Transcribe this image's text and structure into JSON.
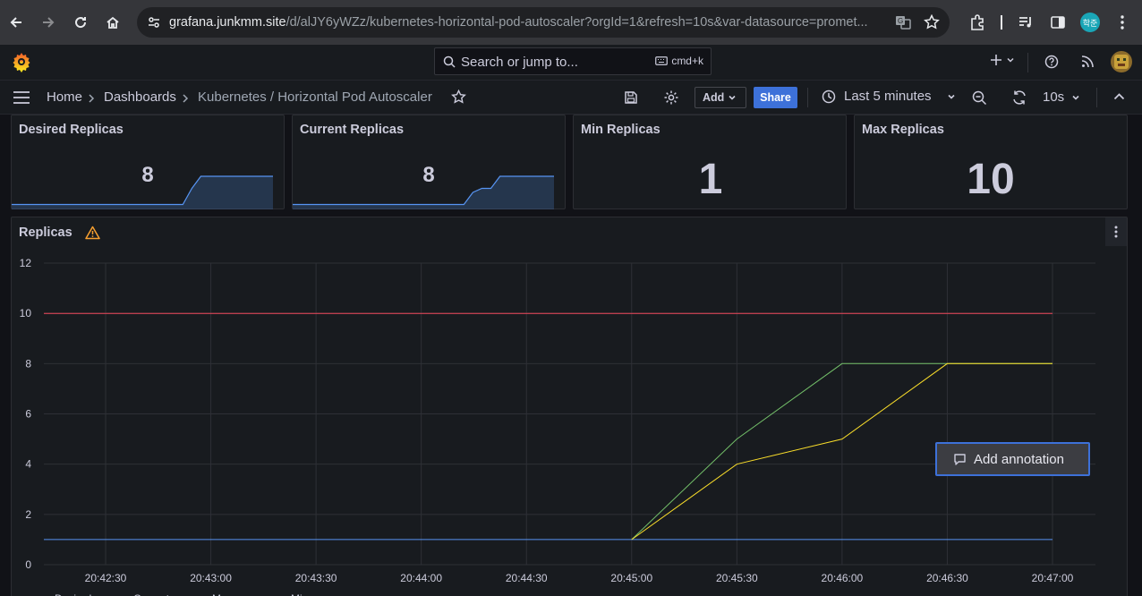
{
  "browser": {
    "url_host": "grafana.junkmm.site",
    "url_path": "/d/alJY6yWZz/kubernetes-horizontal-pod-autoscaler?orgId=1&refresh=10s&var-datasource=promet...",
    "profile_initial": "학준"
  },
  "topnav": {
    "search_placeholder": "Search or jump to...",
    "shortcut": "cmd+k"
  },
  "breadcrumb": {
    "home": "Home",
    "dashboards": "Dashboards",
    "current": "Kubernetes / Horizontal Pod Autoscaler"
  },
  "toolbar": {
    "add_label": "Add",
    "share_label": "Share",
    "time_range": "Last 5 minutes",
    "refresh_interval": "10s"
  },
  "stats": [
    {
      "title": "Desired Replicas",
      "value": "8",
      "sparkline": [
        1,
        1,
        1,
        1,
        1,
        1,
        1,
        1,
        1,
        1,
        1,
        1,
        1,
        1,
        1,
        1,
        1,
        1,
        1,
        1,
        5,
        8,
        8,
        8,
        8,
        8,
        8,
        8,
        8,
        8
      ]
    },
    {
      "title": "Current Replicas",
      "value": "8",
      "sparkline": [
        1,
        1,
        1,
        1,
        1,
        1,
        1,
        1,
        1,
        1,
        1,
        1,
        1,
        1,
        1,
        1,
        1,
        1,
        1,
        1,
        4,
        5,
        5,
        8,
        8,
        8,
        8,
        8,
        8,
        8
      ]
    },
    {
      "title": "Min Replicas",
      "value": "1"
    },
    {
      "title": "Max Replicas",
      "value": "10"
    }
  ],
  "replicas_panel": {
    "title": "Replicas",
    "annotation_label": "Add annotation",
    "legend_partial": [
      "Desired",
      "Current",
      "Max",
      "Min"
    ]
  },
  "chart_data": {
    "type": "line",
    "title": "Replicas",
    "x": [
      "20:42:30",
      "20:43:00",
      "20:43:30",
      "20:44:00",
      "20:44:30",
      "20:45:00",
      "20:45:30",
      "20:46:00",
      "20:46:30",
      "20:47:00"
    ],
    "ylim": [
      0,
      12
    ],
    "yticks": [
      0,
      2,
      4,
      6,
      8,
      10,
      12
    ],
    "grid": true,
    "series": [
      {
        "name": "Max",
        "color": "#f2495c",
        "points": [
          [
            "20:42:15",
            10
          ],
          [
            "20:47:00",
            10
          ]
        ]
      },
      {
        "name": "Min",
        "color": "#5794f2",
        "points": [
          [
            "20:42:15",
            1
          ],
          [
            "20:47:00",
            1
          ]
        ]
      },
      {
        "name": "Desired",
        "color": "#73bf69",
        "points": [
          [
            "20:45:00",
            1
          ],
          [
            "20:45:30",
            5
          ],
          [
            "20:46:00",
            8
          ],
          [
            "20:46:30",
            8
          ],
          [
            "20:47:00",
            8
          ]
        ]
      },
      {
        "name": "Current",
        "color": "#fade2a",
        "points": [
          [
            "20:45:00",
            1
          ],
          [
            "20:45:30",
            4
          ],
          [
            "20:46:00",
            5
          ],
          [
            "20:46:30",
            8
          ],
          [
            "20:47:00",
            8
          ]
        ]
      }
    ]
  }
}
